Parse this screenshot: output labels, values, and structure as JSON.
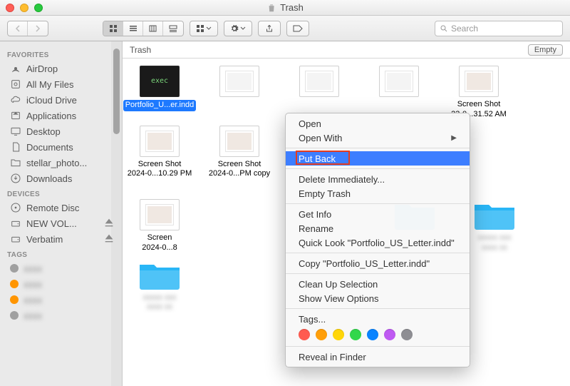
{
  "window": {
    "title": "Trash"
  },
  "toolbar": {
    "search_placeholder": "Search"
  },
  "sidebar": {
    "sections": [
      {
        "title": "Favorites",
        "items": [
          {
            "icon": "airdrop",
            "label": "AirDrop"
          },
          {
            "icon": "allfiles",
            "label": "All My Files"
          },
          {
            "icon": "cloud",
            "label": "iCloud Drive"
          },
          {
            "icon": "apps",
            "label": "Applications"
          },
          {
            "icon": "desktop",
            "label": "Desktop"
          },
          {
            "icon": "docs",
            "label": "Documents"
          },
          {
            "icon": "folder",
            "label": "stellar_photo..."
          },
          {
            "icon": "downloads",
            "label": "Downloads"
          }
        ]
      },
      {
        "title": "Devices",
        "items": [
          {
            "icon": "disc",
            "label": "Remote Disc"
          },
          {
            "icon": "drive",
            "label": "NEW VOL...",
            "eject": true
          },
          {
            "icon": "drive",
            "label": "Verbatim",
            "eject": true
          }
        ]
      },
      {
        "title": "Tags",
        "items": [
          {
            "tag": "#a0a0a0"
          },
          {
            "tag": "#ff9500"
          },
          {
            "tag": "#ff9500"
          },
          {
            "tag": "#a0a0a0"
          }
        ]
      }
    ]
  },
  "main": {
    "breadcrumb": "Trash",
    "empty_btn": "Empty",
    "files_row1": [
      {
        "type": "exec",
        "name": "Portfolio_U...er.indd",
        "selected": true
      },
      {
        "type": "doc"
      },
      {
        "type": "doc"
      },
      {
        "type": "doc"
      },
      {
        "type": "shot",
        "name1": "Screen Shot",
        "name2": "23-0...31.52 AM"
      },
      {
        "type": "shot",
        "name1": "Screen Shot",
        "name2": "2024-0...10.29 PM"
      },
      {
        "type": "shot",
        "name1": "Screen Shot",
        "name2": "2024-0...PM copy"
      }
    ],
    "files_row2": [
      {
        "type": "shot",
        "name1": "Screen",
        "name2": "2024-0...8"
      },
      {
        "type": "folder",
        "blur": true
      },
      {
        "type": "folder",
        "blur": true
      },
      {
        "type": "folder",
        "blur": true
      }
    ]
  },
  "context_menu": {
    "groups": [
      [
        {
          "label": "Open"
        },
        {
          "label": "Open With",
          "arrow": true
        }
      ],
      [
        {
          "label": "Put Back",
          "highlight": true,
          "box": true
        }
      ],
      [
        {
          "label": "Delete Immediately..."
        },
        {
          "label": "Empty Trash"
        }
      ],
      [
        {
          "label": "Get Info"
        },
        {
          "label": "Rename"
        },
        {
          "label": "Quick Look \"Portfolio_US_Letter.indd\""
        }
      ],
      [
        {
          "label": "Copy \"Portfolio_US_Letter.indd\""
        }
      ],
      [
        {
          "label": "Clean Up Selection"
        },
        {
          "label": "Show View Options"
        }
      ],
      [
        {
          "label": "Tags...",
          "tags": true
        }
      ],
      [
        {
          "label": "Reveal in Finder"
        }
      ]
    ],
    "tag_colors": [
      "#ff5b50",
      "#ff9f0a",
      "#ffd60a",
      "#32d74b",
      "#0a84ff",
      "#bf5af2",
      "#8e8e93"
    ]
  }
}
